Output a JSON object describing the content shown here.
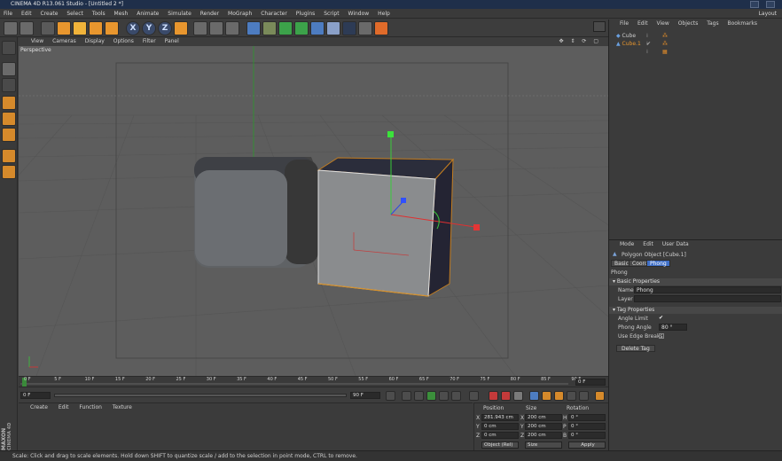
{
  "title": "CINEMA 4D R13.061 Studio - [Untitled 2 *]",
  "window_title_right": "Layout",
  "menu": [
    "File",
    "Edit",
    "Create",
    "Select",
    "Tools",
    "Mesh",
    "Animate",
    "Simulate",
    "Render",
    "MoGraph",
    "Character",
    "Plugins",
    "Script",
    "Window",
    "Help"
  ],
  "viewport": {
    "menu": [
      "View",
      "Cameras",
      "Display",
      "Options",
      "Filter",
      "Panel"
    ],
    "label": "Perspective"
  },
  "toolbar": {
    "axis_x": "X",
    "axis_y": "Y",
    "axis_z": "Z"
  },
  "timeline": {
    "ticks": [
      "0 F",
      "5 F",
      "10 F",
      "15 F",
      "20 F",
      "25 F",
      "30 F",
      "35 F",
      "40 F",
      "45 F",
      "50 F",
      "55 F",
      "60 F",
      "65 F",
      "70 F",
      "75 F",
      "80 F",
      "85 F",
      "90 F"
    ],
    "end_field": "0 F"
  },
  "transport": {
    "start_field": "0 F",
    "end_field": "90 F"
  },
  "material_manager": {
    "menu": [
      "Create",
      "Edit",
      "Function",
      "Texture"
    ]
  },
  "maxon": {
    "brand": "MAXON",
    "product": "CINEMA 4D"
  },
  "coordinates": {
    "headers": {
      "position": "Position",
      "size": "Size",
      "rotation": "Rotation"
    },
    "rows": [
      {
        "axis": "X",
        "pos": "281.943 cm",
        "size_axis": "X",
        "size": "200 cm",
        "rot_axis": "H",
        "rot": "0 °"
      },
      {
        "axis": "Y",
        "pos": "0 cm",
        "size_axis": "Y",
        "size": "200 cm",
        "rot_axis": "P",
        "rot": "0 °"
      },
      {
        "axis": "Z",
        "pos": "0 cm",
        "size_axis": "Z",
        "size": "200 cm",
        "rot_axis": "B",
        "rot": "0 °"
      }
    ],
    "mode_select": "Object (Rel)",
    "size_select": "Size",
    "apply_label": "Apply"
  },
  "object_manager": {
    "menu": [
      "File",
      "Edit",
      "View",
      "Objects",
      "Tags",
      "Bookmarks"
    ],
    "objects": [
      {
        "name": "Cube"
      },
      {
        "name": "Cube.1"
      }
    ]
  },
  "attributes": {
    "menu": [
      "Mode",
      "Edit",
      "User Data"
    ],
    "object_title": "Polygon Object [Cube.1]",
    "tabs": [
      "Basic",
      "Coord.",
      "Phong"
    ],
    "active_tab": "Phong",
    "section_title": "Phong",
    "basic_properties": "Basic Properties",
    "name_label": "Name",
    "name_value": "Phong",
    "layer_label": "Layer",
    "tag_properties": "Tag Properties",
    "angle_limit_label": "Angle Limit",
    "angle_limit_value": "✔",
    "phong_angle_label": "Phong Angle",
    "phong_angle_value": "80 °",
    "edge_breaks_label": "Use Edge Breaks",
    "delete_tag_label": "Delete Tag"
  },
  "status": "Scale: Click and drag to scale elements. Hold down SHIFT to quantize scale / add to the selection in point mode, CTRL to remove."
}
